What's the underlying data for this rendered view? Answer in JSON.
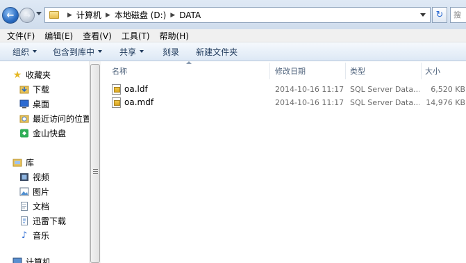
{
  "address": {
    "crumbs": [
      "计算机",
      "本地磁盘 (D:)",
      "DATA"
    ],
    "search_placeholder": "搜"
  },
  "menu": [
    "文件(F)",
    "编辑(E)",
    "查看(V)",
    "工具(T)",
    "帮助(H)"
  ],
  "commands": [
    {
      "label": "组织",
      "dropdown": true
    },
    {
      "label": "包含到库中",
      "dropdown": true
    },
    {
      "label": "共享",
      "dropdown": true
    },
    {
      "label": "刻录",
      "dropdown": false
    },
    {
      "label": "新建文件夹",
      "dropdown": false
    }
  ],
  "nav": {
    "favorites": {
      "label": "收藏夹",
      "items": [
        "下载",
        "桌面",
        "最近访问的位置",
        "金山快盘"
      ]
    },
    "libraries": {
      "label": "库",
      "items": [
        "视频",
        "图片",
        "文档",
        "迅雷下载",
        "音乐"
      ]
    },
    "computer": {
      "label": "计算机"
    }
  },
  "columns": {
    "name": "名称",
    "modified": "修改日期",
    "type": "类型",
    "size": "大小"
  },
  "files": [
    {
      "name": "oa.ldf",
      "modified": "2014-10-16 11:17",
      "type": "SQL Server Data...",
      "size": "6,520 KB"
    },
    {
      "name": "oa.mdf",
      "modified": "2014-10-16 11:17",
      "type": "SQL Server Data...",
      "size": "14,976 KB"
    }
  ],
  "colors": {
    "accent": "#2a6cc2",
    "folder": "#e6bd4e"
  },
  "icons": {
    "back": "back-arrow-icon",
    "forward": "forward-arrow-icon",
    "refresh": "refresh-icon",
    "favorites": "star-icon",
    "downloads": "download-folder-icon",
    "desktop": "desktop-icon",
    "recent": "recent-places-icon",
    "kuaipan": "kuaipan-icon",
    "libraries": "library-icon",
    "videos": "video-icon",
    "pictures": "picture-icon",
    "documents": "document-icon",
    "thunder": "thunder-download-icon",
    "music": "music-icon",
    "computer": "computer-icon",
    "file": "sql-data-file-icon"
  }
}
